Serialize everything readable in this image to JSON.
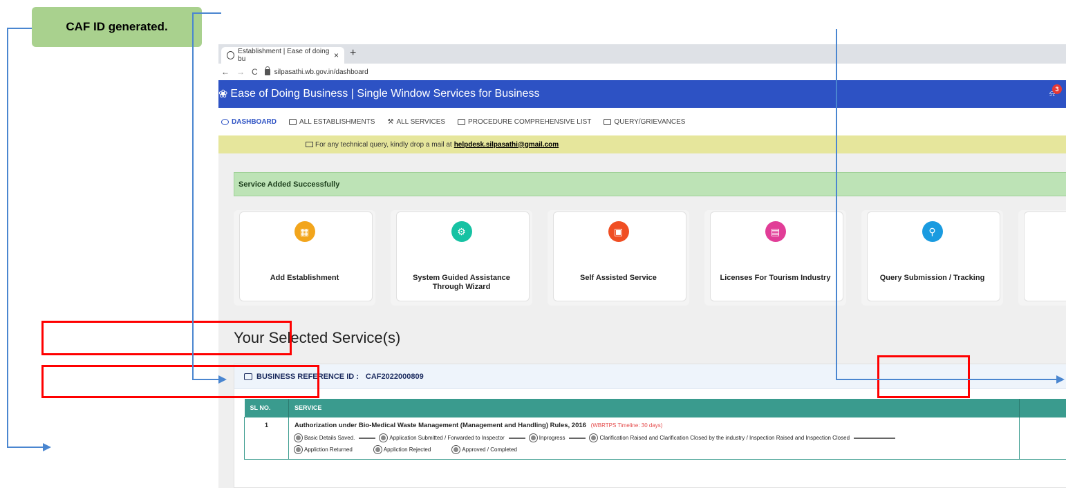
{
  "annotation": {
    "callout_text": "CAF ID generated."
  },
  "browser": {
    "tab_title": "Establishment | Ease of doing bu",
    "tab_close": "×",
    "new_tab": "+",
    "url": "silpasathi.wb.gov.in/dashboard"
  },
  "header": {
    "title": "Ease of Doing Business | Single Window Services for Business",
    "notification_count": "3"
  },
  "menu": {
    "items": [
      {
        "label": "DASHBOARD"
      },
      {
        "label": "ALL ESTABLISHMENTS"
      },
      {
        "label": "ALL SERVICES"
      },
      {
        "label": "PROCEDURE COMPREHENSIVE LIST"
      },
      {
        "label": "QUERY/GRIEVANCES"
      }
    ]
  },
  "notice": {
    "text": "For any technical query, kindly drop a mail at",
    "email": "helpdesk.silpasathi@gmail.com"
  },
  "alert": {
    "success_text": "Service Added Successfully"
  },
  "cards": [
    {
      "label": "Add Establishment",
      "icon": "building-icon",
      "color": "#f2a51c"
    },
    {
      "label": "System Guided Assistance Through Wizard",
      "icon": "gear-icon",
      "color": "#16c2a3"
    },
    {
      "label": "Self Assisted Service",
      "icon": "grid-icon",
      "color": "#f04e23"
    },
    {
      "label": "Licenses For Tourism Industry",
      "icon": "license-icon",
      "color": "#e13d97"
    },
    {
      "label": "Query Submission / Tracking",
      "icon": "search-icon",
      "color": "#1a9be0"
    }
  ],
  "selected": {
    "title": "Your Selected Service(s)",
    "ref_label": "BUSINESS REFERENCE ID :",
    "ref_id": "CAF2022000809"
  },
  "table": {
    "headers": [
      "SL NO.",
      "SERVICE"
    ],
    "rows": [
      {
        "sl": "1",
        "service": "Authorization under Bio-Medical Waste Management (Management and Handling) Rules, 2016",
        "timeline": "(WBRTPS Timeline: 30 days)",
        "steps": [
          "Basic Details Saved.",
          "Application Submitted / Forwarded to Inspector",
          "Inprogress",
          "Clarification Raised and Clarification Closed by the industry / Inspection Raised and Inspection Closed",
          "Appliction Returned",
          "Appliction Rejected",
          "Approved / Completed"
        ]
      }
    ]
  }
}
